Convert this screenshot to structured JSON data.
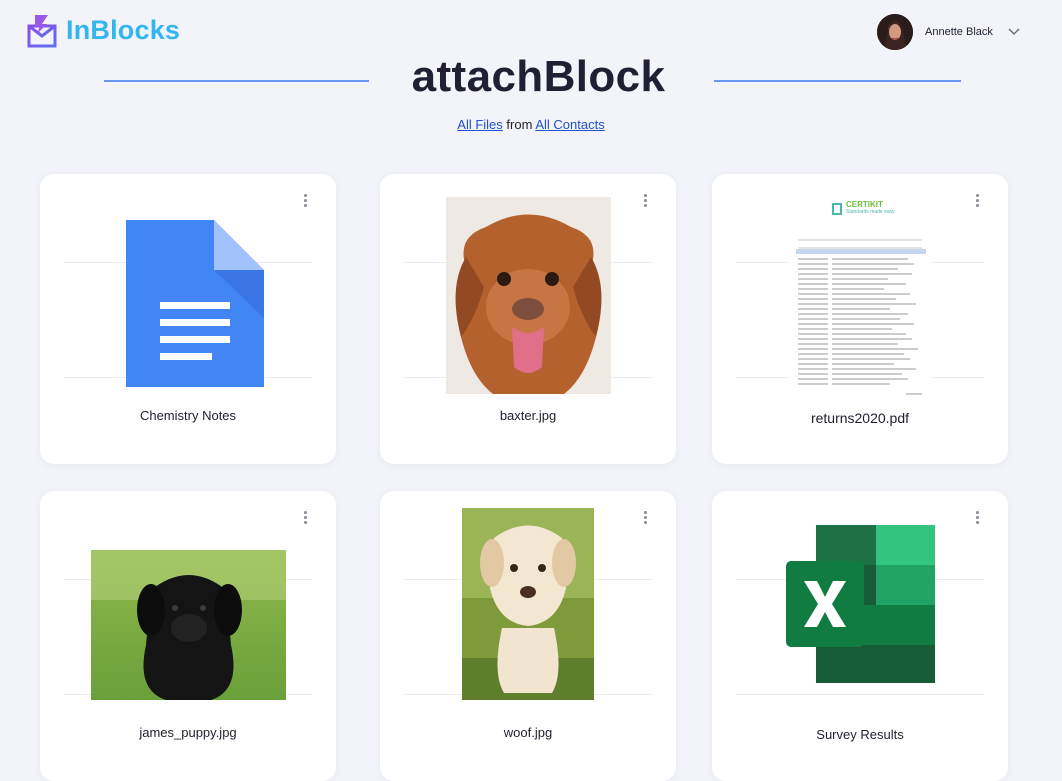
{
  "header": {
    "logo_text": "InBlocks",
    "user_name": "Annette Black"
  },
  "page": {
    "title": "attachBlock",
    "subtitle_link1": "All Files",
    "subtitle_mid": "from",
    "subtitle_link2": "All Contacts"
  },
  "files": [
    {
      "name": "Chemistry Notes",
      "icon": "google-docs-icon"
    },
    {
      "name": "baxter.jpg",
      "icon": "dog-photo"
    },
    {
      "name": "returns2020.pdf",
      "icon": "pdf-document-preview"
    },
    {
      "name": "james_puppy.jpg",
      "icon": "puppy-photo"
    },
    {
      "name": "woof.jpg",
      "icon": "puppy-photo"
    },
    {
      "name": "Survey Results",
      "icon": "excel-icon"
    }
  ],
  "pdf_preview": {
    "brand": "CERTIKIT",
    "tagline": "Standards made easy"
  },
  "colors": {
    "accent": "#33b5f0",
    "link": "#1f4fd3",
    "rule": "#6c95f3",
    "docs_blue": "#4285f4",
    "excel_green": "#1e7145"
  }
}
